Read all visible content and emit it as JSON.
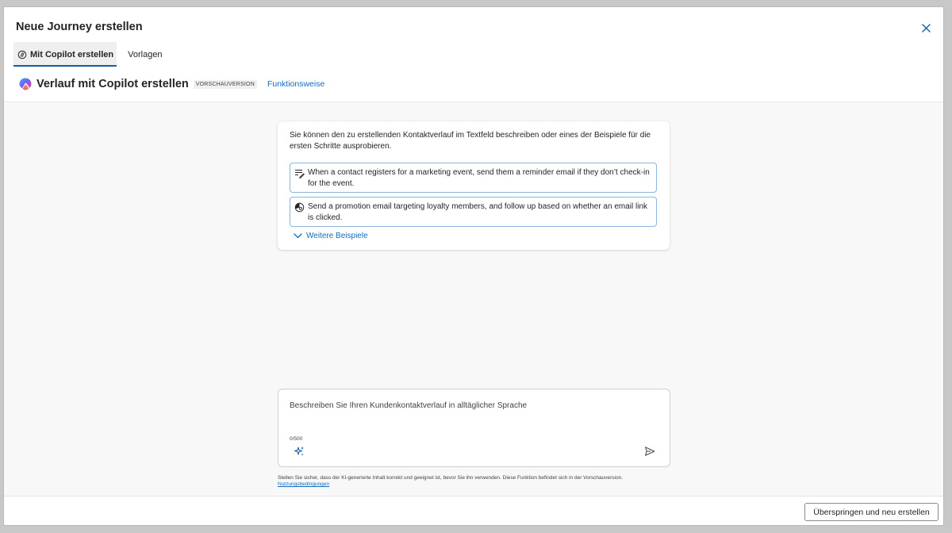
{
  "dialog": {
    "title": "Neue Journey erstellen",
    "close_icon": "close-icon"
  },
  "tabs": [
    {
      "label": "Mit Copilot erstellen",
      "active": true,
      "icon": "copilot-outline-icon"
    },
    {
      "label": "Vorlagen",
      "active": false
    }
  ],
  "subheader": {
    "title": "Verlauf mit Copilot erstellen",
    "badge": "VORSCHAUVERSION",
    "link": "Funktionsweise"
  },
  "intro": {
    "text": "Sie können den zu erstellenden Kontaktverlauf im Textfeld beschreiben oder eines der Beispiele für die ersten Schritte ausprobieren.",
    "examples": [
      {
        "icon": "text-edit-icon",
        "text": "When a contact registers for a marketing event, send them a reminder email if they don’t check-in for the event."
      },
      {
        "icon": "loyalty-icon",
        "text": "Send a promotion email targeting loyalty members, and follow up based on whether an email link is clicked."
      }
    ],
    "more_examples": "Weitere Beispiele"
  },
  "prompt": {
    "placeholder": "Beschreiben Sie Ihren Kundenkontaktverlauf in alltäglicher Sprache",
    "char_count": "0/500"
  },
  "disclaimer": {
    "text": "Stellen Sie sicher, dass der KI-generierte Inhalt korrekt und geeignet ist, bevor Sie ihn verwenden. Diese Funktion befindet sich in der Vorschauversion.",
    "terms_link": "Nutzungsbedingungen"
  },
  "footer": {
    "skip_button": "Überspringen und neu erstellen"
  },
  "colors": {
    "accent": "#0f6cbd",
    "tab_underline": "#115ea3",
    "example_border": "#8bb5e0"
  }
}
